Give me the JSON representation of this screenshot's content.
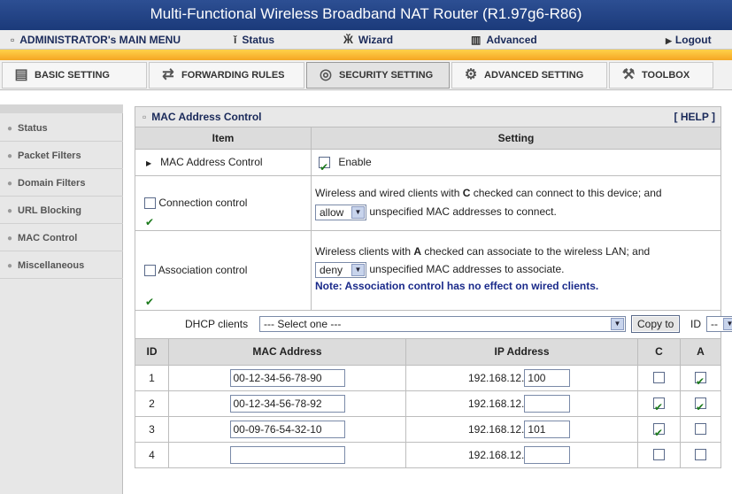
{
  "title": "Multi-Functional Wireless Broadband NAT Router (R1.97g6-R86)",
  "main_menu": {
    "admin": "ADMINISTRATOR's MAIN MENU",
    "status": "Status",
    "wizard": "Wizard",
    "advanced": "Advanced",
    "logout": "Logout"
  },
  "tabs": {
    "basic": "BASIC SETTING",
    "forwarding": "FORWARDING RULES",
    "security": "SECURITY SETTING",
    "advanced": "ADVANCED SETTING",
    "toolbox": "TOOLBOX"
  },
  "sidebar": {
    "items": [
      {
        "label": "Status"
      },
      {
        "label": "Packet Filters"
      },
      {
        "label": "Domain Filters"
      },
      {
        "label": "URL Blocking"
      },
      {
        "label": "MAC Control"
      },
      {
        "label": "Miscellaneous"
      }
    ]
  },
  "panel": {
    "title": "MAC Address Control",
    "help": "[ HELP ]",
    "col_item": "Item",
    "col_setting": "Setting",
    "mac_control_label": "MAC Address Control",
    "enable_label": "Enable",
    "enable_checked": true,
    "conn_label": "Connection control",
    "conn_checked": true,
    "conn_desc_pre": "Wireless and wired clients with ",
    "conn_desc_letter": "C",
    "conn_desc_post": " checked can connect to this device; and",
    "conn_select": "allow",
    "conn_desc2": "unspecified MAC addresses to connect.",
    "assoc_label": "Association control",
    "assoc_checked": true,
    "assoc_desc_pre": "Wireless clients with ",
    "assoc_desc_letter": "A",
    "assoc_desc_post": " checked can associate to the wireless LAN; and",
    "assoc_select": "deny",
    "assoc_desc2": "unspecified MAC addresses to associate.",
    "assoc_note": "Note: Association control has no effect on wired clients.",
    "dhcp_label": "DHCP clients",
    "dhcp_select": "--- Select one ---",
    "copy_button": "Copy to",
    "id_label": "ID",
    "id_select": "--"
  },
  "table": {
    "headers": {
      "id": "ID",
      "mac": "MAC Address",
      "ip": "IP Address",
      "c": "C",
      "a": "A"
    },
    "ip_prefix": "192.168.12.",
    "rows": [
      {
        "id": "1",
        "mac": "00-12-34-56-78-90",
        "ip_suffix": "100",
        "c": false,
        "a": true
      },
      {
        "id": "2",
        "mac": "00-12-34-56-78-92",
        "ip_suffix": "",
        "c": true,
        "a": true
      },
      {
        "id": "3",
        "mac": "00-09-76-54-32-10",
        "ip_suffix": "101",
        "c": true,
        "a": false
      },
      {
        "id": "4",
        "mac": "",
        "ip_suffix": "",
        "c": false,
        "a": false
      }
    ]
  }
}
